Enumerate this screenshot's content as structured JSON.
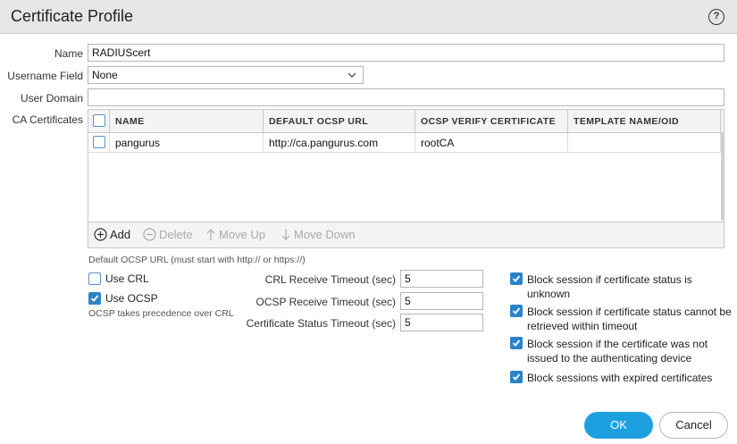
{
  "dialog": {
    "title": "Certificate Profile",
    "help_icon": "question-circle-icon"
  },
  "form": {
    "name_label": "Name",
    "name_value": "RADIUScert",
    "username_field_label": "Username Field",
    "username_field_value": "None",
    "user_domain_label": "User Domain",
    "user_domain_value": "",
    "ca_certificates_label": "CA Certificates"
  },
  "table": {
    "columns": [
      "NAME",
      "DEFAULT OCSP URL",
      "OCSP VERIFY CERTIFICATE",
      "TEMPLATE NAME/OID"
    ],
    "rows": [
      {
        "name": "pangurus",
        "ocsp_url": "http://ca.pangurus.com",
        "verify_cert": "rootCA",
        "template": ""
      }
    ],
    "toolbar": {
      "add": "Add",
      "delete": "Delete",
      "move_up": "Move Up",
      "move_down": "Move Down"
    }
  },
  "ocsp_hint": "Default OCSP URL (must start with http:// or https://)",
  "options": {
    "use_crl": {
      "label": "Use CRL",
      "checked": false
    },
    "use_ocsp": {
      "label": "Use OCSP",
      "checked": true
    },
    "precedence_note": "OCSP takes precedence over CRL"
  },
  "timeouts": {
    "crl_label": "CRL Receive Timeout (sec)",
    "crl_value": "5",
    "ocsp_label": "OCSP Receive Timeout (sec)",
    "ocsp_value": "5",
    "status_label": "Certificate Status Timeout (sec)",
    "status_value": "5"
  },
  "block": {
    "unknown": {
      "label": "Block session if certificate status is unknown",
      "checked": true
    },
    "timeout": {
      "label": "Block session if certificate status cannot be retrieved within timeout",
      "checked": true
    },
    "not_issued": {
      "label": "Block session if the certificate was not issued to the authenticating device",
      "checked": true
    },
    "expired": {
      "label": "Block sessions with expired certificates",
      "checked": true
    }
  },
  "buttons": {
    "ok": "OK",
    "cancel": "Cancel"
  },
  "colors": {
    "accent": "#1ea0e0",
    "checkbox": "#2a83c9",
    "header_bg": "#e6e6e6"
  }
}
